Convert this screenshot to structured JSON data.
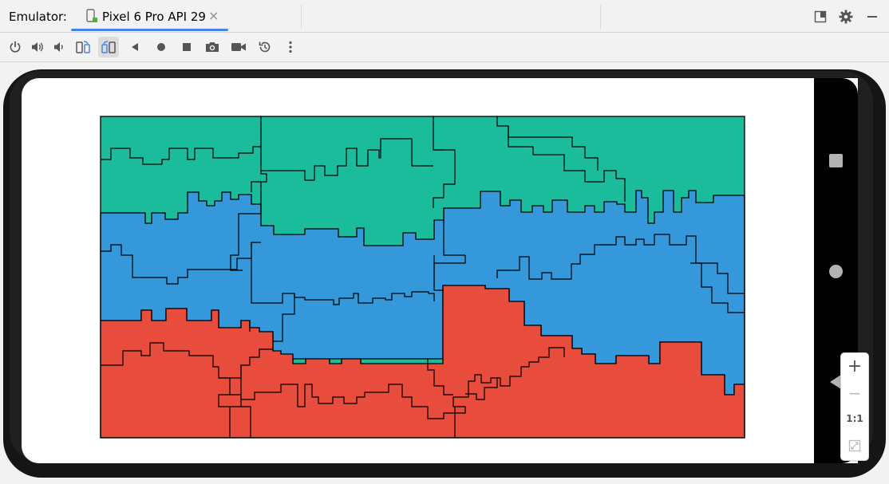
{
  "header": {
    "label": "Emulator:",
    "tab_title": "Pixel 6 Pro API 29",
    "tab_close": "×"
  },
  "zoom_controls": {
    "plus": "+",
    "minus": "−",
    "one_to_one": "1:1"
  },
  "colors": {
    "green": "#1abc9c",
    "blue": "#3498db",
    "red": "#e74c3c",
    "accent": "#4682e6"
  },
  "toolbar_icons": [
    "power-icon",
    "volume-up-icon",
    "volume-down-icon",
    "rotate-left-icon",
    "rotate-right-icon",
    "back-icon",
    "home-icon",
    "overview-icon",
    "screenshot-icon",
    "record-icon",
    "snapshot-icon",
    "more-icon"
  ]
}
